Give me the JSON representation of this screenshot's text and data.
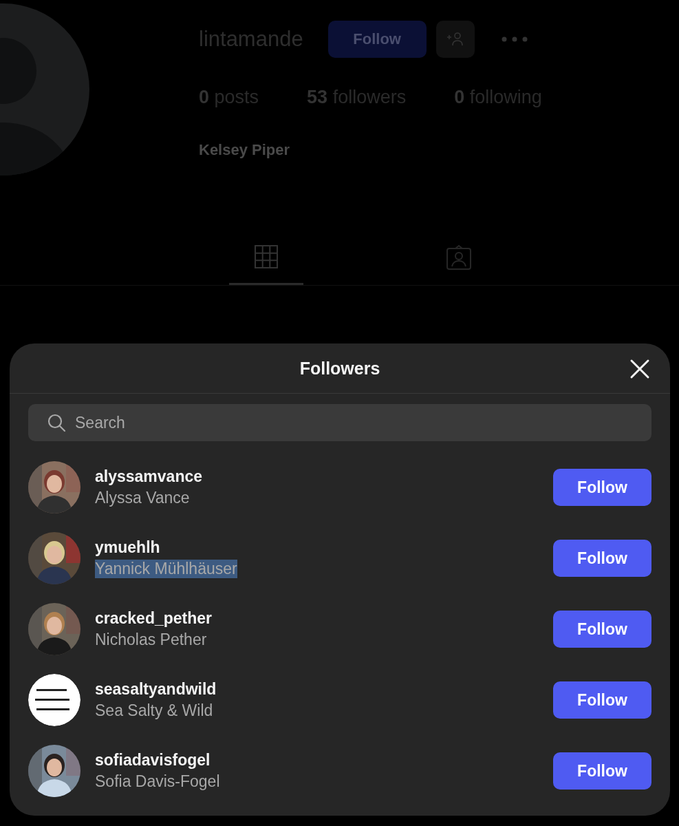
{
  "profile": {
    "username": "lintamande",
    "follow_button": "Follow",
    "stats": [
      {
        "count": "0",
        "label": "posts"
      },
      {
        "count": "53",
        "label": "followers"
      },
      {
        "count": "0",
        "label": "following"
      }
    ],
    "name": "Kelsey Piper",
    "tabs": [
      {
        "kind": "grid",
        "selected": true
      },
      {
        "kind": "tagged",
        "selected": false
      }
    ]
  },
  "dialog": {
    "title": "Followers",
    "search": {
      "placeholder": "Search"
    },
    "users": [
      {
        "username": "alyssamvance",
        "name": "Alyssa Vance",
        "highlighted": false,
        "button": "Follow"
      },
      {
        "username": "ymuehlh",
        "name": "Yannick Mühlhäuser",
        "highlighted": true,
        "button": "Follow"
      },
      {
        "username": "cracked_pether",
        "name": "Nicholas Pether",
        "highlighted": false,
        "button": "Follow"
      },
      {
        "username": "seasaltyandwild",
        "name": "Sea Salty & Wild",
        "highlighted": false,
        "kind": "logo",
        "button": "Follow"
      },
      {
        "username": "sofiadavisfogel",
        "name": "Sofia Davis-Fogel",
        "highlighted": false,
        "button": "Follow"
      }
    ]
  }
}
